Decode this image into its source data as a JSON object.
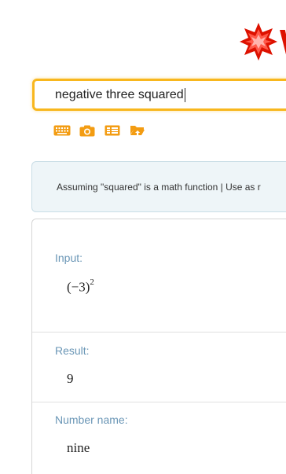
{
  "logo": {
    "letter": "W",
    "icon": "wolfram-spikey-icon",
    "brand_color": "#dd1100"
  },
  "search": {
    "value": "negative three squared",
    "border_color": "#f8b71e"
  },
  "tools": [
    {
      "name": "keyboard-icon"
    },
    {
      "name": "camera-icon"
    },
    {
      "name": "examples-icon"
    },
    {
      "name": "upload-icon"
    }
  ],
  "assumption": {
    "prefix": "Assuming \"squared\" is a math function | Use as ",
    "link": "r"
  },
  "pods": {
    "input": {
      "title": "Input:",
      "base": "(−3)",
      "exponent": "2"
    },
    "result": {
      "title": "Result:",
      "value": "9"
    },
    "number_name": {
      "title": "Number name:",
      "value": "nine"
    }
  },
  "colors": {
    "pod_title": "#6a96b6",
    "assumption_bg": "#eef5f8",
    "tool_orange": "#f39c12"
  }
}
